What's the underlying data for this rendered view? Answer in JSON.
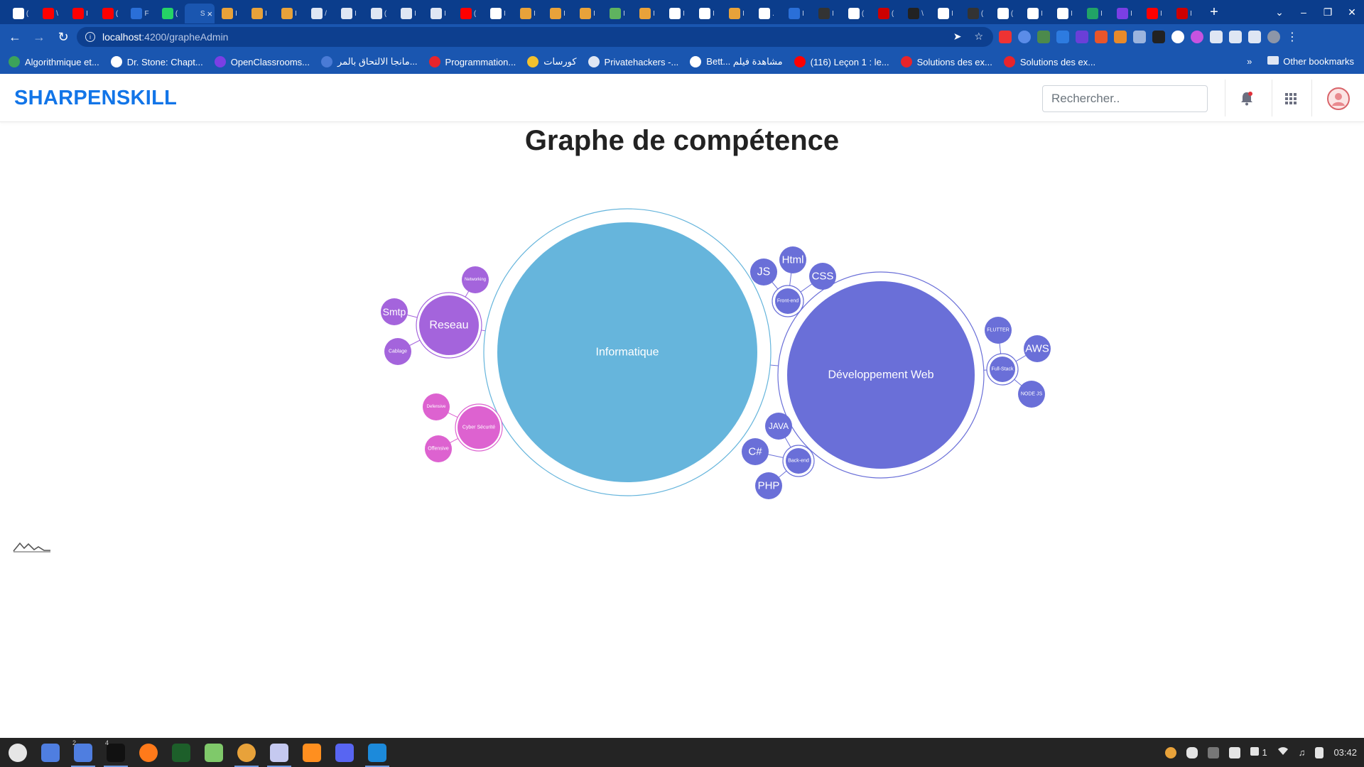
{
  "browser": {
    "url_host": "localhost",
    "url_path": ":4200/grapheAdmin",
    "tabs": [
      {
        "char": "(",
        "color": "#ffffff"
      },
      {
        "char": "\\",
        "color": "#ff0000"
      },
      {
        "char": "I",
        "color": "#ff0000"
      },
      {
        "char": "(",
        "color": "#ff0000"
      },
      {
        "char": "F",
        "color": "#2a6fd8"
      },
      {
        "char": "(",
        "color": "#25d366"
      },
      {
        "char": "S",
        "color": "#1a56b0",
        "active": true,
        "close": "×"
      },
      {
        "char": "I",
        "color": "#e8a23a"
      },
      {
        "char": "I",
        "color": "#e8a23a"
      },
      {
        "char": "I",
        "color": "#e8a23a"
      },
      {
        "char": "/",
        "color": "#dfe6f3"
      },
      {
        "char": "I",
        "color": "#dfe6f3"
      },
      {
        "char": "(",
        "color": "#dfe6f3"
      },
      {
        "char": "I",
        "color": "#dfe6f3"
      },
      {
        "char": "I",
        "color": "#dfe6f3"
      },
      {
        "char": "(",
        "color": "#ff0000"
      },
      {
        "char": "I",
        "color": "#ffffff"
      },
      {
        "char": "I",
        "color": "#e8a23a"
      },
      {
        "char": "I",
        "color": "#e8a23a"
      },
      {
        "char": "I",
        "color": "#e8a23a"
      },
      {
        "char": "I",
        "color": "#5fb35f"
      },
      {
        "char": "I",
        "color": "#e8a23a"
      },
      {
        "char": "I",
        "color": "#ffffff"
      },
      {
        "char": "I",
        "color": "#ffffff"
      },
      {
        "char": "I",
        "color": "#e8a23a"
      },
      {
        "char": ".",
        "color": "#ffffff"
      },
      {
        "char": "I",
        "color": "#2a6fd8"
      },
      {
        "char": "I",
        "color": "#333333"
      },
      {
        "char": "(",
        "color": "#ffffff"
      },
      {
        "char": "(",
        "color": "#cc0000"
      },
      {
        "char": "\\",
        "color": "#222222"
      },
      {
        "char": "I",
        "color": "#ffffff"
      },
      {
        "char": "(",
        "color": "#333333"
      },
      {
        "char": "(",
        "color": "#ffffff"
      },
      {
        "char": "I",
        "color": "#ffffff"
      },
      {
        "char": "I",
        "color": "#ffffff"
      },
      {
        "char": "I",
        "color": "#21a366"
      },
      {
        "char": "I",
        "color": "#7b3fe4"
      },
      {
        "char": "I",
        "color": "#ff0000"
      },
      {
        "char": "I",
        "color": "#cc0000"
      }
    ],
    "new_tab": "+",
    "bookmarks": [
      {
        "label": "Algorithmique et...",
        "color": "#3ca35a"
      },
      {
        "label": "Dr. Stone: Chapt...",
        "color": "#ffffff"
      },
      {
        "label": "OpenClassrooms...",
        "color": "#7b3fe4"
      },
      {
        "label": "مانجا الالتحاق بالمر...",
        "color": "#4a7bd6"
      },
      {
        "label": "Programmation...",
        "color": "#e8242b"
      },
      {
        "label": "كورسات",
        "color": "#f2c12e"
      },
      {
        "label": "Privatehackers -...",
        "color": "#dfe6f3"
      },
      {
        "label": "Bett... مشاهدة فيلم",
        "color": "#ffffff"
      },
      {
        "label": "(116) Leçon 1 : le...",
        "color": "#ff0000"
      },
      {
        "label": "Solutions des ex...",
        "color": "#e8242b"
      },
      {
        "label": "Solutions des ex...",
        "color": "#e8242b"
      }
    ],
    "bookmarks_more": "»",
    "other_bookmarks": "Other bookmarks"
  },
  "header": {
    "brand": "SHARPENSKILL",
    "search_placeholder": "Rechercher.."
  },
  "page": {
    "title": "Graphe de compétence"
  },
  "graph": {
    "colors": {
      "informatique": "#66b5dc",
      "web": "#6a6fd8",
      "reseau": "#a464dc",
      "cyber": "#dd62d0"
    },
    "nodes": [
      {
        "id": "informatique",
        "label": "Informatique",
        "group": "informatique"
      },
      {
        "id": "web",
        "label": "Développement Web",
        "group": "web"
      },
      {
        "id": "frontend",
        "label": "Front-end",
        "group": "web"
      },
      {
        "id": "js",
        "label": "JS",
        "group": "web"
      },
      {
        "id": "html",
        "label": "Html",
        "group": "web"
      },
      {
        "id": "css",
        "label": "CSS",
        "group": "web"
      },
      {
        "id": "fullstack",
        "label": "Full-Stack",
        "group": "web"
      },
      {
        "id": "flutter",
        "label": "FLUTTER",
        "group": "web"
      },
      {
        "id": "aws",
        "label": "AWS",
        "group": "web"
      },
      {
        "id": "nodejs",
        "label": "NODE JS",
        "group": "web"
      },
      {
        "id": "backend",
        "label": "Back-end",
        "group": "web"
      },
      {
        "id": "java",
        "label": "JAVA",
        "group": "web"
      },
      {
        "id": "csharp",
        "label": "C#",
        "group": "web"
      },
      {
        "id": "php",
        "label": "PHP",
        "group": "web"
      },
      {
        "id": "reseau",
        "label": "Reseau",
        "group": "reseau"
      },
      {
        "id": "networking",
        "label": "Networking",
        "group": "reseau"
      },
      {
        "id": "smtp",
        "label": "Smtp",
        "group": "reseau"
      },
      {
        "id": "cablage",
        "label": "Cablage",
        "group": "reseau"
      },
      {
        "id": "cyber",
        "label": "Cyber Sécurité",
        "group": "cyber"
      },
      {
        "id": "defensive",
        "label": "Defensive",
        "group": "cyber"
      },
      {
        "id": "offensive",
        "label": "Offensive",
        "group": "cyber"
      }
    ],
    "links": [
      [
        "informatique",
        "web"
      ],
      [
        "informatique",
        "reseau"
      ],
      [
        "informatique",
        "cyber"
      ],
      [
        "web",
        "frontend"
      ],
      [
        "web",
        "fullstack"
      ],
      [
        "web",
        "backend"
      ],
      [
        "frontend",
        "js"
      ],
      [
        "frontend",
        "html"
      ],
      [
        "frontend",
        "css"
      ],
      [
        "fullstack",
        "flutter"
      ],
      [
        "fullstack",
        "aws"
      ],
      [
        "fullstack",
        "nodejs"
      ],
      [
        "backend",
        "java"
      ],
      [
        "backend",
        "csharp"
      ],
      [
        "backend",
        "php"
      ],
      [
        "reseau",
        "networking"
      ],
      [
        "reseau",
        "smtp"
      ],
      [
        "reseau",
        "cablage"
      ],
      [
        "cyber",
        "defensive"
      ],
      [
        "cyber",
        "offensive"
      ]
    ]
  },
  "taskbar": {
    "apps": [
      {
        "name": "mint-menu",
        "color": "#e6e6e6"
      },
      {
        "name": "file-manager",
        "color": "#4f7ee0"
      },
      {
        "name": "file-manager-2",
        "color": "#4f7ee0",
        "count": "2",
        "active": true
      },
      {
        "name": "terminal",
        "color": "#111111",
        "count": "4",
        "active": true
      },
      {
        "name": "firefox",
        "color": "#ff7a1a"
      },
      {
        "name": "system-monitor",
        "color": "#1d5f2a"
      },
      {
        "name": "box-app",
        "color": "#7fc96a"
      },
      {
        "name": "chrome",
        "color": "#e8a23a",
        "active": true
      },
      {
        "name": "text-editor",
        "color": "#c5c9f0",
        "active": true
      },
      {
        "name": "sublime",
        "color": "#ff8f1f"
      },
      {
        "name": "discord",
        "color": "#5865f2"
      },
      {
        "name": "vscode",
        "color": "#1c8adb",
        "active": true
      }
    ],
    "tray_badge": "1",
    "clock": "03:42"
  }
}
